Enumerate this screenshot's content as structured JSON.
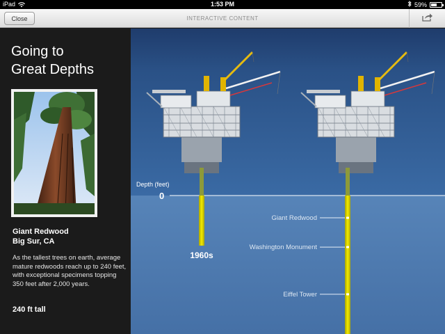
{
  "status_bar": {
    "device": "iPad",
    "time": "1:53 PM",
    "battery": "59%",
    "battery_level": 0.59
  },
  "nav": {
    "close_label": "Close",
    "title": "INTERACTIVE CONTENT"
  },
  "sidebar": {
    "title_line1": "Going to",
    "title_line2": "Great Depths",
    "item_name_line1": "Giant Redwood",
    "item_name_line2": "Big Sur, CA",
    "description": "As the tallest trees on earth, average mature redwoods reach up to 240 feet, with exceptional specimens topping 350 feet after 2,000 years.",
    "height_stat": "240 ft tall"
  },
  "chart": {
    "axis_label": "Depth (feet)",
    "zero_label": "0",
    "era_label": "1960s",
    "colors": {
      "sea": "#4e79ae",
      "sky": "#2e4f86",
      "drill": "#f0e600",
      "surface_line": "#ffffff"
    }
  },
  "chart_data": {
    "type": "bar",
    "unit": "feet",
    "zero_label": "0",
    "series": [
      {
        "name": "1960s",
        "depth": 240
      }
    ],
    "landmarks": [
      {
        "label": "Giant Redwood",
        "depth": 240
      },
      {
        "label": "Washington Monument",
        "depth": 555
      },
      {
        "label": "Eiffel Tower",
        "depth": 1063
      }
    ]
  }
}
